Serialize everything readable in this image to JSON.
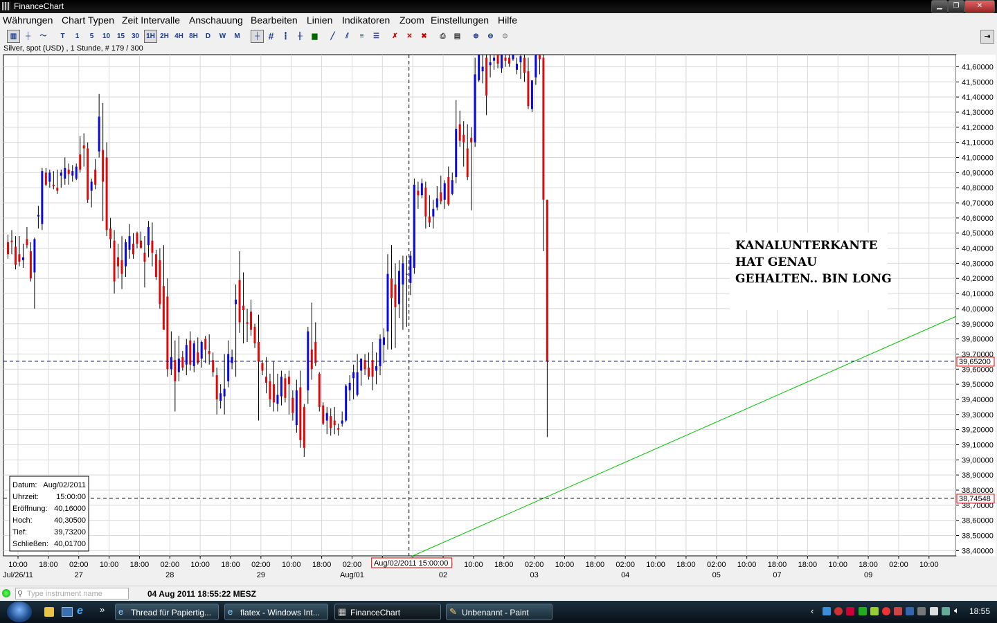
{
  "window": {
    "title": "FinanceChart"
  },
  "menu": [
    "Währungen",
    "Chart Typen",
    "Zeit Intervalle",
    "Anschauung",
    "Bearbeiten",
    "Linien",
    "Indikatoren",
    "Zoom",
    "Einstellungen",
    "Hilfe"
  ],
  "toolbar": {
    "intervals": [
      "T",
      "1",
      "5",
      "10",
      "15",
      "30",
      "1H",
      "2H",
      "4H",
      "8H",
      "D",
      "W",
      "M"
    ],
    "selected_interval": "1H"
  },
  "instrument_line": "Silver, spot (USD) , 1 Stunde, # 179 / 300",
  "chart_data": {
    "type": "candlestick",
    "y_ticks": [
      "41,60000",
      "41,50000",
      "41,40000",
      "41,30000",
      "41,20000",
      "41,10000",
      "41,00000",
      "40,90000",
      "40,80000",
      "40,70000",
      "40,60000",
      "40,50000",
      "40,40000",
      "40,30000",
      "40,20000",
      "40,10000",
      "40,00000",
      "39,90000",
      "39,80000",
      "39,70000",
      "39,60000",
      "39,50000",
      "39,40000",
      "39,30000",
      "39,20000",
      "39,10000",
      "39,00000",
      "38,90000",
      "38,80000",
      "38,70000",
      "38,60000",
      "38,50000",
      "38,40000"
    ],
    "x_ticks": [
      "10:00",
      "18:00",
      "02:00",
      "10:00",
      "18:00",
      "02:00",
      "10:00",
      "18:00",
      "02:00",
      "10:00",
      "18:00",
      "02:00",
      "10:00",
      "18:00",
      "02:00",
      "10:00",
      "18:00",
      "02:00",
      "10:00",
      "18:00",
      "02:00",
      "10:00",
      "18:00",
      "02:00",
      "10:00",
      "18:00",
      "18:00",
      "10:00",
      "18:00",
      "02:00",
      "10:00"
    ],
    "date_labels": [
      "Jul/26/11",
      "27",
      "28",
      "29",
      "Aug/01",
      "02",
      "03",
      "04",
      "05",
      "07",
      "09"
    ],
    "ohlc": [
      [
        40.44,
        40.49,
        40.33,
        40.36
      ],
      [
        40.45,
        40.52,
        40.36,
        40.44
      ],
      [
        40.41,
        40.48,
        40.26,
        40.29
      ],
      [
        40.36,
        40.48,
        40.28,
        40.31
      ],
      [
        40.32,
        40.43,
        40.27,
        40.34
      ],
      [
        40.46,
        40.54,
        40.4,
        40.42
      ],
      [
        40.38,
        40.44,
        40.18,
        40.2
      ],
      [
        40.24,
        40.47,
        40.0,
        40.46
      ],
      [
        40.61,
        40.68,
        40.53,
        40.62
      ],
      [
        40.56,
        40.93,
        40.52,
        40.91
      ],
      [
        40.9,
        40.93,
        40.81,
        40.82
      ],
      [
        40.84,
        40.92,
        40.8,
        40.9
      ],
      [
        40.82,
        40.91,
        40.79,
        40.81
      ],
      [
        40.8,
        40.92,
        40.76,
        40.78
      ],
      [
        40.88,
        40.92,
        40.8,
        40.9
      ],
      [
        40.86,
        41.0,
        40.82,
        40.93
      ],
      [
        40.92,
        40.96,
        40.82,
        40.89
      ],
      [
        40.88,
        40.95,
        40.84,
        40.91
      ],
      [
        40.86,
        40.96,
        40.85,
        40.94
      ],
      [
        41.02,
        41.14,
        40.9,
        40.92
      ],
      [
        41.08,
        41.16,
        40.94,
        41.06
      ],
      [
        41.06,
        41.1,
        40.7,
        40.72
      ],
      [
        40.78,
        40.86,
        40.67,
        40.84
      ],
      [
        40.92,
        40.99,
        40.79,
        40.82
      ],
      [
        41.04,
        41.42,
        41.0,
        41.27
      ],
      [
        41.05,
        41.36,
        40.58,
        40.84
      ],
      [
        41.0,
        41.1,
        40.48,
        40.52
      ],
      [
        40.53,
        40.6,
        40.4,
        40.46
      ],
      [
        40.45,
        40.52,
        40.1,
        40.18
      ],
      [
        40.34,
        40.43,
        40.2,
        40.28
      ],
      [
        40.32,
        40.48,
        40.13,
        40.23
      ],
      [
        40.28,
        40.46,
        40.21,
        40.44
      ],
      [
        40.39,
        40.56,
        40.33,
        40.48
      ],
      [
        40.43,
        40.5,
        40.33,
        40.36
      ],
      [
        40.5,
        40.51,
        40.4,
        40.43
      ],
      [
        40.45,
        40.51,
        40.4,
        40.4
      ],
      [
        40.37,
        40.48,
        40.14,
        40.31
      ],
      [
        40.42,
        40.58,
        40.34,
        40.54
      ],
      [
        40.45,
        40.57,
        40.28,
        40.37
      ],
      [
        40.36,
        40.39,
        40.19,
        40.21
      ],
      [
        40.32,
        40.4,
        40.0,
        40.03
      ],
      [
        40.15,
        40.42,
        39.86,
        39.86
      ],
      [
        40.08,
        40.2,
        39.55,
        39.6
      ],
      [
        39.6,
        39.85,
        39.56,
        39.68
      ],
      [
        39.66,
        39.79,
        39.32,
        39.52
      ],
      [
        39.58,
        39.82,
        39.52,
        39.67
      ],
      [
        39.68,
        39.72,
        39.59,
        39.61
      ],
      [
        39.63,
        39.8,
        39.56,
        39.76
      ],
      [
        39.79,
        39.85,
        39.59,
        39.63
      ],
      [
        39.62,
        39.79,
        39.58,
        39.77
      ],
      [
        39.71,
        39.81,
        39.63,
        39.64
      ],
      [
        39.67,
        39.79,
        39.61,
        39.78
      ],
      [
        39.8,
        39.82,
        39.64,
        39.73
      ],
      [
        39.72,
        39.83,
        39.63,
        39.7
      ],
      [
        39.66,
        39.71,
        39.55,
        39.58
      ],
      [
        39.56,
        39.61,
        39.3,
        39.4
      ],
      [
        39.39,
        39.5,
        39.34,
        39.44
      ],
      [
        39.42,
        39.7,
        39.3,
        39.47
      ],
      [
        39.52,
        39.79,
        39.48,
        39.7
      ],
      [
        39.64,
        39.73,
        39.6,
        39.68
      ],
      [
        40.03,
        40.16,
        39.55,
        40.06
      ],
      [
        40.19,
        40.38,
        39.84,
        39.91
      ],
      [
        40.02,
        40.24,
        39.77,
        39.99
      ],
      [
        39.91,
        40.0,
        39.78,
        39.9
      ],
      [
        39.98,
        40.06,
        39.82,
        39.86
      ],
      [
        39.88,
        39.9,
        39.74,
        39.77
      ],
      [
        39.78,
        39.96,
        39.26,
        39.65
      ],
      [
        39.64,
        39.66,
        39.56,
        39.59
      ],
      [
        39.55,
        39.68,
        39.44,
        39.51
      ],
      [
        39.52,
        39.57,
        39.35,
        39.4
      ],
      [
        39.5,
        39.65,
        39.32,
        39.38
      ],
      [
        39.37,
        39.57,
        39.32,
        39.43
      ],
      [
        39.42,
        39.59,
        39.36,
        39.55
      ],
      [
        39.54,
        39.57,
        39.38,
        39.41
      ],
      [
        39.55,
        39.59,
        39.3,
        39.5
      ],
      [
        39.41,
        39.46,
        39.26,
        39.31
      ],
      [
        39.23,
        39.53,
        39.18,
        39.46
      ],
      [
        39.48,
        39.59,
        39.08,
        39.13
      ],
      [
        39.35,
        39.37,
        39.02,
        39.08
      ],
      [
        39.46,
        39.88,
        39.37,
        39.85
      ],
      [
        39.73,
        40.04,
        39.53,
        39.6
      ],
      [
        39.78,
        39.91,
        39.62,
        39.64
      ],
      [
        39.57,
        39.58,
        39.32,
        39.35
      ],
      [
        39.36,
        39.38,
        39.23,
        39.24
      ],
      [
        39.26,
        39.35,
        39.17,
        39.31
      ],
      [
        39.29,
        39.34,
        39.16,
        39.21
      ],
      [
        39.26,
        39.35,
        39.17,
        39.23
      ],
      [
        39.21,
        39.24,
        39.16,
        39.2
      ],
      [
        39.24,
        39.32,
        39.22,
        39.26
      ],
      [
        39.26,
        39.5,
        39.25,
        39.49
      ],
      [
        39.46,
        39.56,
        39.39,
        39.51
      ],
      [
        39.54,
        39.63,
        39.4,
        39.58
      ],
      [
        39.43,
        39.7,
        39.42,
        39.58
      ],
      [
        39.59,
        39.67,
        39.49,
        39.67
      ],
      [
        39.66,
        39.7,
        39.56,
        39.6
      ],
      [
        39.61,
        39.71,
        39.53,
        39.55
      ],
      [
        39.66,
        39.78,
        39.46,
        39.55
      ],
      [
        39.59,
        39.71,
        39.5,
        39.62
      ],
      [
        39.62,
        39.83,
        39.56,
        39.8
      ],
      [
        39.76,
        39.87,
        39.64,
        39.81
      ],
      [
        39.85,
        40.36,
        39.73,
        40.23
      ],
      [
        40.2,
        40.42,
        39.73,
        40.07
      ],
      [
        40.16,
        40.3,
        39.74,
        40.01
      ],
      [
        40.03,
        40.32,
        39.94,
        40.25
      ],
      [
        40.16,
        40.35,
        39.86,
        40.3
      ],
      [
        40.23,
        40.35,
        39.88,
        40.23
      ],
      [
        40.17,
        40.38,
        40.09,
        40.35
      ],
      [
        40.27,
        40.86,
        40.23,
        40.82
      ],
      [
        40.78,
        40.84,
        40.66,
        40.75
      ],
      [
        40.75,
        40.86,
        40.73,
        40.83
      ],
      [
        40.8,
        40.84,
        40.53,
        40.61
      ],
      [
        40.61,
        40.75,
        40.54,
        40.57
      ],
      [
        40.61,
        40.72,
        40.53,
        40.66
      ],
      [
        40.67,
        40.81,
        40.65,
        40.73
      ],
      [
        40.77,
        40.88,
        40.69,
        40.71
      ],
      [
        40.72,
        40.85,
        40.66,
        40.83
      ],
      [
        40.87,
        40.94,
        40.68,
        40.69
      ],
      [
        40.76,
        40.9,
        40.75,
        40.85
      ],
      [
        40.87,
        41.38,
        40.83,
        41.19
      ],
      [
        41.22,
        41.31,
        41.07,
        41.11
      ],
      [
        41.15,
        41.24,
        40.94,
        41.1
      ],
      [
        41.06,
        41.22,
        40.85,
        40.87
      ],
      [
        41.13,
        41.2,
        40.65,
        41.1
      ],
      [
        41.1,
        41.66,
        41.07,
        41.55
      ],
      [
        41.51,
        41.75,
        41.5,
        41.7
      ],
      [
        41.57,
        41.7,
        41.49,
        41.6
      ],
      [
        41.66,
        41.7,
        41.28,
        41.41
      ],
      [
        41.61,
        41.78,
        41.53,
        41.63
      ],
      [
        41.64,
        41.7,
        41.58,
        41.66
      ],
      [
        41.68,
        41.72,
        41.59,
        41.62
      ],
      [
        41.59,
        41.75,
        41.56,
        41.7
      ],
      [
        41.66,
        41.7,
        41.6,
        41.64
      ],
      [
        41.66,
        41.71,
        41.6,
        41.62
      ],
      [
        41.65,
        41.7,
        41.64,
        41.68
      ],
      [
        41.58,
        41.66,
        41.55,
        41.62
      ],
      [
        41.63,
        41.76,
        41.52,
        41.67
      ],
      [
        41.66,
        41.75,
        41.5,
        41.56
      ],
      [
        41.57,
        41.66,
        41.32,
        41.34
      ],
      [
        41.32,
        41.5,
        41.3,
        41.51
      ],
      [
        41.53,
        41.72,
        41.48,
        41.7
      ],
      [
        41.7,
        41.72,
        41.55,
        41.65
      ],
      [
        41.66,
        41.68,
        40.38,
        40.72
      ],
      [
        40.72,
        40.72,
        39.15,
        39.652
      ]
    ],
    "trendline": {
      "from": {
        "date": "Aug/02/2011 01:00",
        "value": 38.37
      },
      "to": {
        "date": "Aug/09/2011 05:00",
        "value": 39.93
      }
    },
    "crosshair": {
      "date": "Aug/02/2011 15:00:00",
      "value": "38,74548"
    },
    "current_price": "39,65200",
    "annotation": [
      "KANALUNTERKANTE",
      "HAT GENAU",
      "GEHALTEN.. BIN LONG"
    ],
    "y_range": [
      38.365,
      41.68
    ],
    "up_color": "#0a0adc",
    "down_color": "#dc0a0a",
    "trend_color": "#00c000"
  },
  "info_box": {
    "rows": [
      {
        "label": "Datum:",
        "value": "Aug/02/2011"
      },
      {
        "label": "Uhrzeit:",
        "value": "15:00:00"
      },
      {
        "label": "Eröffnung:",
        "value": "40,16000"
      },
      {
        "label": "Hoch:",
        "value": "40,30500"
      },
      {
        "label": "Tief:",
        "value": "39,73200"
      },
      {
        "label": "Schließen:",
        "value": "40,01700"
      }
    ]
  },
  "status": {
    "search_placeholder": "Type instrument name",
    "timestamp": "04 Aug 2011 18:55:22 MESZ"
  },
  "taskbar": {
    "items": [
      "Thread für Papiertig...",
      "flatex - Windows Int...",
      "FinanceChart",
      "Unbenannt - Paint"
    ],
    "active": "FinanceChart",
    "clock": "18:55",
    "overflow": "»"
  }
}
